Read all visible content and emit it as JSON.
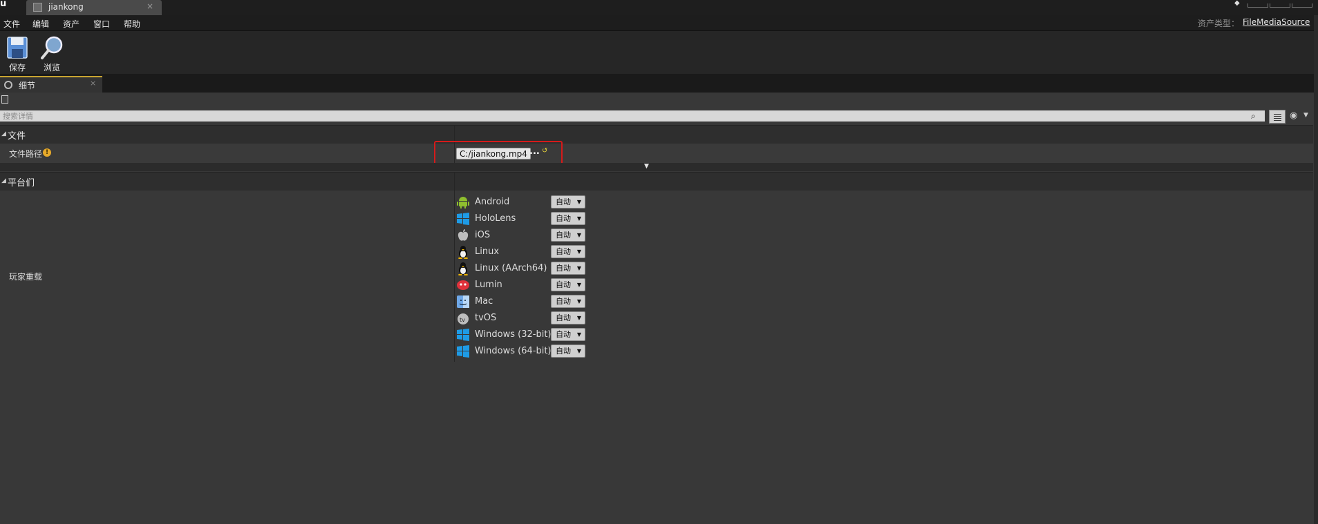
{
  "window": {
    "doc_tab_label": "jiankong",
    "doc_tab_close": "×"
  },
  "menu": {
    "items": [
      "文件",
      "编辑",
      "资产",
      "窗口",
      "帮助"
    ],
    "asset_type_label": "资产类型：",
    "asset_type_value": "FileMediaSource"
  },
  "toolbar": {
    "save_label": "保存",
    "browse_label": "浏览"
  },
  "details_panel": {
    "tab_label": "细节",
    "tab_close": "×",
    "search_placeholder": "搜索详情"
  },
  "file_category": {
    "title": "文件",
    "file_path_label": "文件路径",
    "file_path_value": "C:/jiankong.mp4",
    "browse_button_label": "..."
  },
  "platforms_category": {
    "title": "平台们",
    "player_overrides_label": "玩家重载",
    "platforms": [
      {
        "name": "Android",
        "icon": "android-icon",
        "value": "自动"
      },
      {
        "name": "HoloLens",
        "icon": "windows-icon",
        "value": "自动"
      },
      {
        "name": "iOS",
        "icon": "apple-icon",
        "value": "自动"
      },
      {
        "name": "Linux",
        "icon": "linux-penguin-icon",
        "value": "自动"
      },
      {
        "name": "Linux (AArch64)",
        "icon": "linux-penguin-icon",
        "value": "自动"
      },
      {
        "name": "Lumin",
        "icon": "lumin-icon",
        "value": "自动"
      },
      {
        "name": "Mac",
        "icon": "mac-finder-icon",
        "value": "自动"
      },
      {
        "name": "tvOS",
        "icon": "apple-tv-icon",
        "value": "自动"
      },
      {
        "name": "Windows (32-bit)",
        "icon": "windows-icon",
        "value": "自动"
      },
      {
        "name": "Windows (64-bit)",
        "icon": "windows-icon",
        "value": "自动"
      }
    ]
  },
  "colors": {
    "highlight_box": "#d61a1a",
    "tab_accent": "#c8a430",
    "warning": "#e6a92a"
  }
}
